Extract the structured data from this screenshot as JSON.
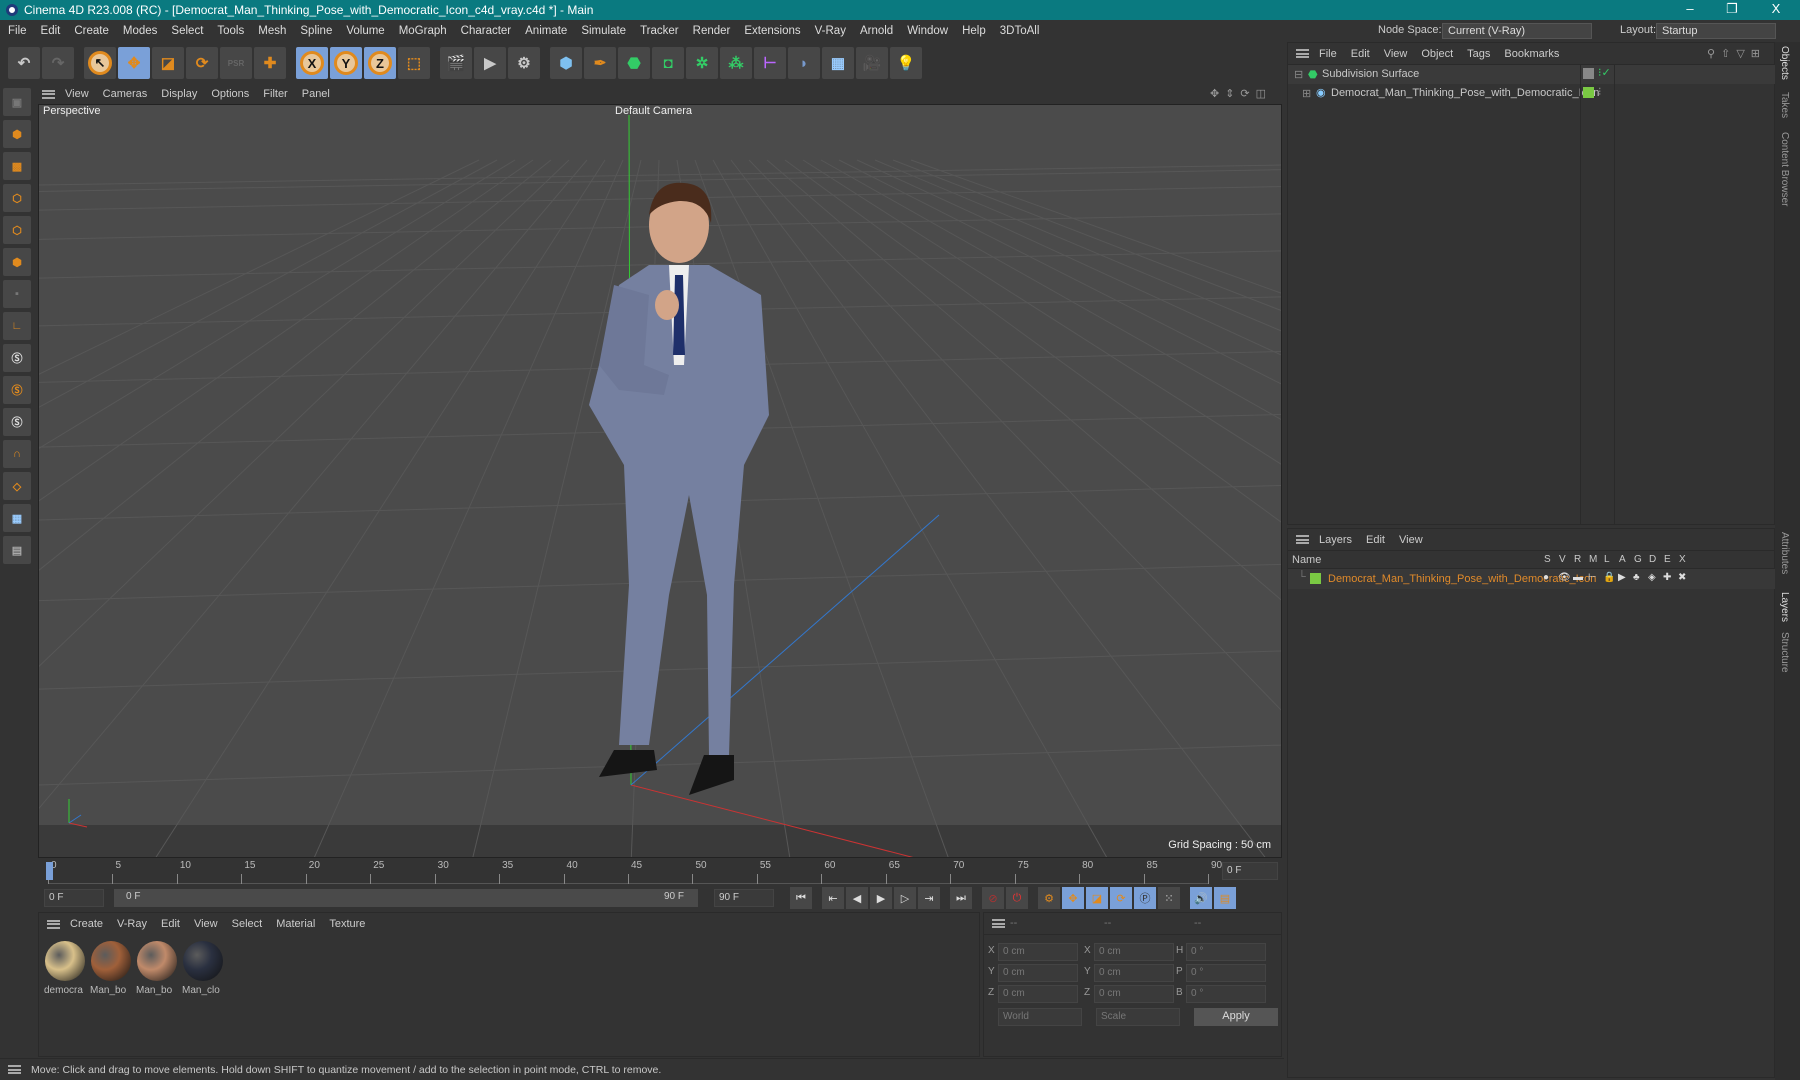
{
  "title": "Cinema 4D R23.008 (RC) - [Democrat_Man_Thinking_Pose_with_Democratic_Icon_c4d_vray.c4d *] - Main",
  "window_controls": {
    "minimize": "–",
    "restore": "❐",
    "close": "X"
  },
  "menu": [
    "File",
    "Edit",
    "Create",
    "Modes",
    "Select",
    "Tools",
    "Mesh",
    "Spline",
    "Volume",
    "MoGraph",
    "Character",
    "Animate",
    "Simulate",
    "Tracker",
    "Render",
    "Extensions",
    "V-Ray",
    "Arnold",
    "Window",
    "Help",
    "3DToAll"
  ],
  "node_space": {
    "label": "Node Space:",
    "value": "Current (V-Ray)"
  },
  "layout": {
    "label": "Layout:",
    "value": "Startup"
  },
  "toolbar": {
    "x": "X",
    "y": "Y",
    "z": "Z",
    "psr": "PSR"
  },
  "viewport": {
    "menu": [
      "View",
      "Cameras",
      "Display",
      "Options",
      "Filter",
      "Panel"
    ],
    "name": "Perspective",
    "camera": "Default Camera",
    "grid_spacing": "Grid Spacing : 50 cm"
  },
  "timeline": {
    "ticks": [
      "0",
      "5",
      "10",
      "15",
      "20",
      "25",
      "30",
      "35",
      "40",
      "45",
      "50",
      "55",
      "60",
      "65",
      "70",
      "75",
      "80",
      "85",
      "90"
    ],
    "current": "0 F",
    "start": "0 F",
    "range_start": "0 F",
    "range_end": "90 F",
    "end": "90 F"
  },
  "materials": {
    "menu": [
      "Create",
      "V-Ray",
      "Edit",
      "View",
      "Select",
      "Material",
      "Texture"
    ],
    "items": [
      {
        "name": "democra",
        "color": "#d8c08a"
      },
      {
        "name": "Man_bo",
        "color": "#a0603a"
      },
      {
        "name": "Man_bo",
        "color": "#c08a6a"
      },
      {
        "name": "Man_clo",
        "color": "#2a3040"
      }
    ]
  },
  "coords": {
    "headers": [
      "--",
      "--",
      "--"
    ],
    "rows": [
      {
        "a": "X",
        "av": "0 cm",
        "b": "X",
        "bv": "0 cm",
        "c": "H",
        "cv": "0 °"
      },
      {
        "a": "Y",
        "av": "0 cm",
        "b": "Y",
        "bv": "0 cm",
        "c": "P",
        "cv": "0 °"
      },
      {
        "a": "Z",
        "av": "0 cm",
        "b": "Z",
        "bv": "0 cm",
        "c": "B",
        "cv": "0 °"
      }
    ],
    "world": "World",
    "scale": "Scale",
    "apply": "Apply"
  },
  "status": "Move: Click and drag to move elements. Hold down SHIFT to quantize movement / add to the selection in point mode, CTRL to remove.",
  "objects": {
    "menu": [
      "File",
      "Edit",
      "View",
      "Object",
      "Tags",
      "Bookmarks"
    ],
    "items": [
      {
        "name": "Subdivision Surface"
      },
      {
        "name": "Democrat_Man_Thinking_Pose_with_Democratic_Icon"
      }
    ]
  },
  "layers": {
    "menu": [
      "Layers",
      "Edit",
      "View"
    ],
    "name_header": "Name",
    "columns": [
      "S",
      "V",
      "R",
      "M",
      "L",
      "A",
      "G",
      "D",
      "E",
      "X"
    ],
    "item": "Democrat_Man_Thinking_Pose_with_Democratic_Icon",
    "item_color": "#e08a2a",
    "swatch": "#7ac943"
  },
  "side_tabs": [
    "Objects",
    "Takes",
    "Content Browser",
    "Attributes",
    "Layers",
    "Structure"
  ]
}
